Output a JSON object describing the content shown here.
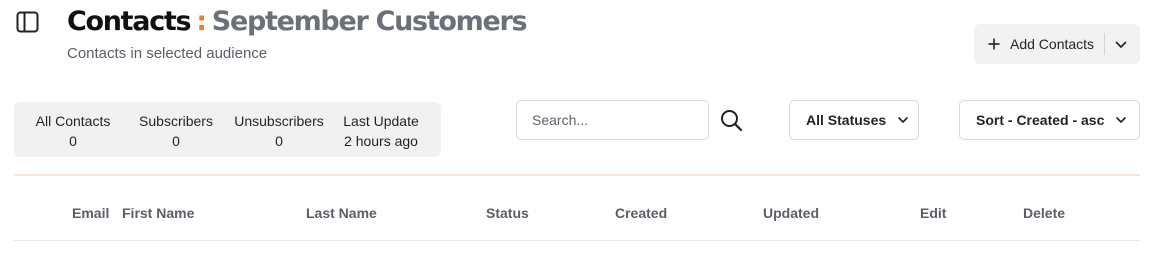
{
  "header": {
    "title": "Contacts",
    "separator": ":",
    "audience_name": "September Customers",
    "subtitle": "Contacts in selected audience"
  },
  "actions": {
    "add_contacts_label": "Add Contacts"
  },
  "stats": [
    {
      "label": "All Contacts",
      "value": "0"
    },
    {
      "label": "Subscribers",
      "value": "0"
    },
    {
      "label": "Unsubscribers",
      "value": "0"
    },
    {
      "label": "Last Update",
      "value": "2 hours ago"
    }
  ],
  "search": {
    "placeholder": "Search...",
    "value": ""
  },
  "filters": {
    "status_label": "All Statuses",
    "sort_label": "Sort - Created - asc"
  },
  "table": {
    "columns": [
      "Email",
      "First Name",
      "Last Name",
      "Status",
      "Created",
      "Updated",
      "Edit",
      "Delete"
    ]
  },
  "colors": {
    "accent": "#f07f2a",
    "title": "#111111",
    "audience": "#6b7079",
    "panel_bg": "#f1f1f2",
    "accent_line": "#fde3c8"
  },
  "icons": {
    "sidebar_toggle": "sidebar-icon",
    "add": "plus-icon",
    "dropdown": "chevron-down-icon",
    "search": "search-icon"
  }
}
